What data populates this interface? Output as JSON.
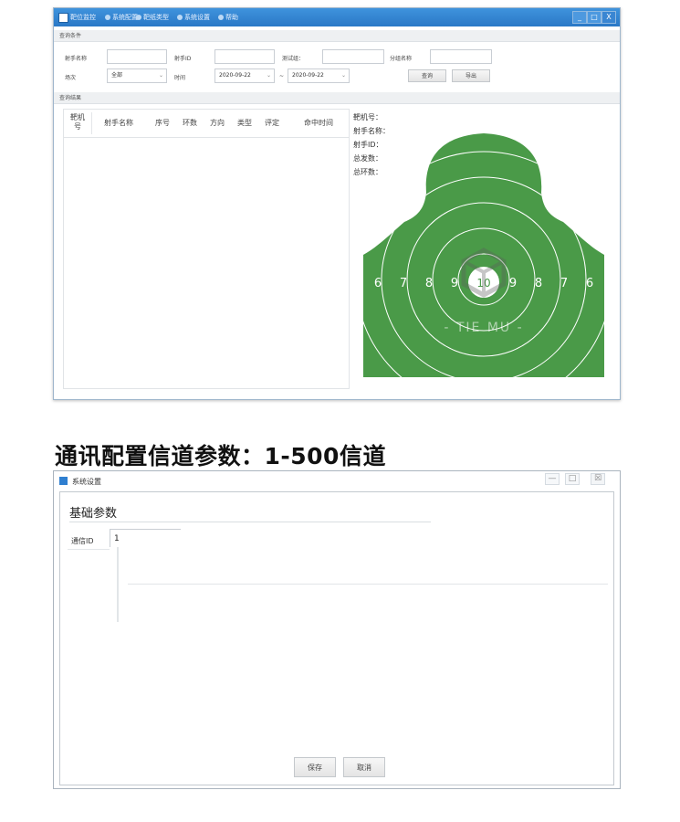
{
  "window1": {
    "title": "靶位监控",
    "title_tabs": [
      "系统配置",
      "靶纸类型",
      "系统设置",
      "帮助"
    ],
    "controls": {
      "minimize": "_",
      "maximize": "□",
      "close": "X"
    },
    "query_section": {
      "title": "查询条件",
      "shooter_name_label": "射手名称",
      "shooter_id_label": "射手ID",
      "test_name_label": "测试组：",
      "group_name_label": "分组名称",
      "session_label": "场次",
      "session_value": "全部",
      "time_label": "时间",
      "date_from": "2020-09-22",
      "date_sep": "~",
      "date_to": "2020-09-22",
      "query_button": "查询",
      "export_button": "导出"
    },
    "results_section": {
      "title": "查询结果",
      "columns": [
        "靶机号",
        "射手名称",
        "序号",
        "环数",
        "方向",
        "类型",
        "评定",
        "命中时间"
      ]
    },
    "info_panel": {
      "target_id_label": "靶机号：",
      "shooter_name_label": "射手名称：",
      "shooter_id_label": "射手ID：",
      "total_shots_label": "总发数：",
      "total_rings_label": "总环数："
    },
    "target": {
      "color": "#4a9a48",
      "center_color": "#ffffff",
      "left_numbers": [
        "6",
        "7",
        "8",
        "9"
      ],
      "center_number": "10",
      "right_numbers": [
        "9",
        "8",
        "7",
        "6"
      ],
      "watermark": "- TIE MU -"
    }
  },
  "heading": "通讯配置信道参数：1-500信道",
  "window2": {
    "title": "系统设置",
    "controls": {
      "minimize": "—",
      "maximize": "□",
      "close": "☒"
    },
    "section_title": "基础参数",
    "channel_label": "通信ID",
    "channel_value": "1",
    "save_button": "保存",
    "cancel_button": "取消"
  }
}
